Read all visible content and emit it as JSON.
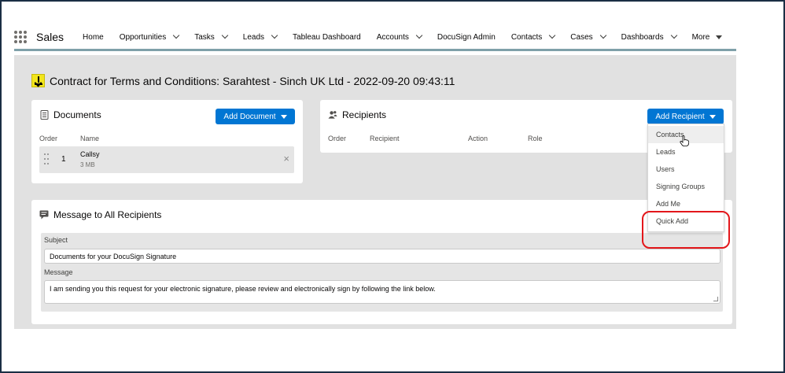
{
  "nav": {
    "app_name": "Sales",
    "items": [
      {
        "label": "Home",
        "has_chevron": false
      },
      {
        "label": "Opportunities",
        "has_chevron": true
      },
      {
        "label": "Tasks",
        "has_chevron": true
      },
      {
        "label": "Leads",
        "has_chevron": true
      },
      {
        "label": "Tableau Dashboard",
        "has_chevron": false
      },
      {
        "label": "Accounts",
        "has_chevron": true
      },
      {
        "label": "DocuSign Admin",
        "has_chevron": false
      },
      {
        "label": "Contacts",
        "has_chevron": true
      },
      {
        "label": "Cases",
        "has_chevron": true
      },
      {
        "label": "Dashboards",
        "has_chevron": true
      },
      {
        "label": "More",
        "has_chevron": false
      }
    ]
  },
  "page": {
    "title": "Contract for Terms and Conditions: Sarahtest - Sinch UK Ltd - 2022-09-20 09:43:11"
  },
  "documents": {
    "heading": "Documents",
    "add_button": "Add Document",
    "col_order": "Order",
    "col_name": "Name",
    "rows": [
      {
        "order": "1",
        "name": "Callsy",
        "size": "3 MB"
      }
    ]
  },
  "recipients": {
    "heading": "Recipients",
    "add_button": "Add Recipient",
    "col_order": "Order",
    "col_recipient": "Recipient",
    "col_action": "Action",
    "col_role": "Role",
    "menu": [
      "Contacts",
      "Leads",
      "Users",
      "Signing Groups",
      "Add Me",
      "Quick Add"
    ]
  },
  "message": {
    "heading": "Message to All Recipients",
    "subject_label": "Subject",
    "subject_value": "Documents for your DocuSign Signature",
    "message_label": "Message",
    "message_value": "I am sending you this request for your electronic signature, please review and electronically sign by following the link below."
  },
  "colors": {
    "brand_blue": "#0176d3",
    "highlight_red": "#e3171b",
    "icon_yellow": "#f2e51c"
  }
}
